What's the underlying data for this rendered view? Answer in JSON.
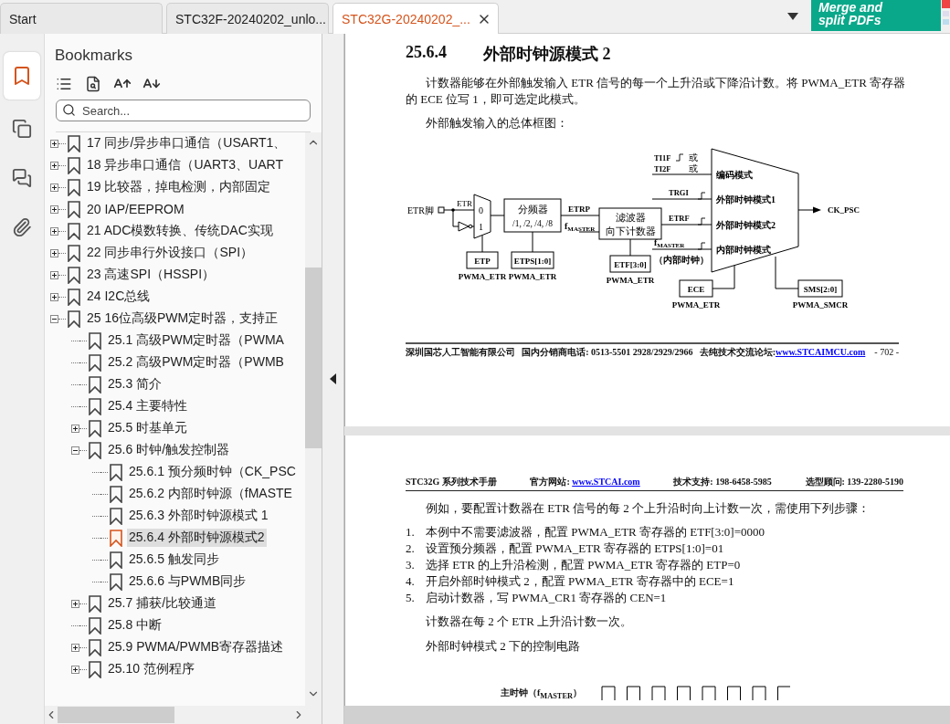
{
  "tabs": [
    {
      "label": "Start",
      "selected": false
    },
    {
      "label": "STC32F-20240202_unlo...",
      "selected": false
    },
    {
      "label": "STC32G-20240202_...",
      "selected": true
    }
  ],
  "ad": {
    "lines": [
      "Merge and",
      "split PDFs"
    ]
  },
  "rail": [
    {
      "kind": "bookmarks",
      "selected": true
    },
    {
      "kind": "pages",
      "selected": false
    },
    {
      "kind": "comments",
      "selected": false
    },
    {
      "kind": "attachments",
      "selected": false
    }
  ],
  "sidebar": {
    "title": "Bookmarks",
    "search": {
      "placeholder": "Search..."
    },
    "items": [
      {
        "label": "17 同步/异步串口通信（USART1、",
        "selected": false,
        "expanded": false
      },
      {
        "label": "18 异步串口通信（UART3、UART",
        "selected": false,
        "expanded": false
      },
      {
        "label": "19 比较器，掉电检测，内部固定",
        "selected": false,
        "expanded": false
      },
      {
        "label": "20 IAP/EEPROM",
        "selected": false,
        "expanded": false
      },
      {
        "label": "21 ADC模数转换、传统DAC实现",
        "selected": false,
        "expanded": false
      },
      {
        "label": "22 同步串行外设接口（SPI）",
        "selected": false,
        "expanded": false
      },
      {
        "label": "23 高速SPI（HSSPI）",
        "selected": false,
        "expanded": false
      },
      {
        "label": "24 I2C总线",
        "selected": false,
        "expanded": false
      },
      {
        "label": "25 16位高级PWM定时器，支持正",
        "selected": false,
        "expanded": true,
        "children": [
          {
            "label": "25.1 高级PWM定时器（PWMA",
            "selected": false
          },
          {
            "label": "25.2 高级PWM定时器（PWMB",
            "selected": false
          },
          {
            "label": "25.3 简介",
            "selected": false
          },
          {
            "label": "25.4 主要特性",
            "selected": false
          },
          {
            "label": "25.5 时基单元",
            "selected": false,
            "expanded": false
          },
          {
            "label": "25.6 时钟/触发控制器",
            "selected": false,
            "expanded": true,
            "children": [
              {
                "label": "25.6.1 预分频时钟（CK_PSC",
                "selected": false
              },
              {
                "label": "25.6.2 内部时钟源（fMASTE",
                "selected": false
              },
              {
                "label": "25.6.3 外部时钟源模式 1",
                "selected": false
              },
              {
                "label": "25.6.4 外部时钟源模式2",
                "selected": true
              },
              {
                "label": "25.6.5 触发同步",
                "selected": false
              },
              {
                "label": "25.6.6 与PWMB同步",
                "selected": false
              }
            ]
          },
          {
            "label": "25.7 捕获/比较通道",
            "selected": false,
            "expanded": false
          },
          {
            "label": "25.8 中断",
            "selected": false
          },
          {
            "label": "25.9 PWMA/PWMB寄存器描述",
            "selected": false,
            "expanded": false
          },
          {
            "label": "25.10 范例程序",
            "selected": false,
            "expanded": false
          }
        ]
      }
    ]
  },
  "page1": {
    "heading_number": "25.6.4",
    "heading_title": "外部时钟源模式 2",
    "paragraphs": [
      "计数器能够在外部触发输入 ETR 信号的每一个上升沿或下降沿计数。将 PWMA_ETR 寄存器的 ECE 位写 1，即可选定此模式。",
      "外部触发输入的总体框图："
    ],
    "diagram": {
      "pin": "ETR脚",
      "etr": "ETR",
      "mux_inputs": [
        "0",
        "1"
      ],
      "prescaler": [
        "分频器",
        "/1, /2, /4, /8"
      ],
      "etrp": "ETRP",
      "fmaster": {
        "main": "f",
        "sub": "MASTER"
      },
      "filter": [
        "滤波器",
        "向下计数器"
      ],
      "etrf": "ETRF",
      "trgi": "TRGI",
      "ti": [
        "TI1F",
        "TI2F"
      ],
      "or": [
        "或",
        "或"
      ],
      "fmaster_internal": {
        "main": "f",
        "sub": "MASTER"
      },
      "internal": "（内部时钟）",
      "modes": [
        "编码模式",
        "外部时钟模式1",
        "外部时钟模式2",
        "内部时钟模式"
      ],
      "output": "CK_PSC",
      "registers": [
        {
          "field": "ETP",
          "reg": "PWMA_ETR"
        },
        {
          "field": "ETPS[1:0]",
          "reg": "PWMA_ETR"
        },
        {
          "field": "ETF[3:0]",
          "reg": "PWMA_ETR"
        },
        {
          "field": "ECE",
          "reg": "PWMA_ETR"
        },
        {
          "field": "SMS[2:0]",
          "reg": "PWMA_SMCR"
        }
      ]
    },
    "footer": {
      "company": "深圳国芯人工智能有限公司",
      "phone": "国内分销商电话: 0513-5501 2928/2929/2966",
      "forum_label": "去纯技术交流论坛:",
      "forum_link": "www.STCAIMCU.com",
      "page": "- 702 -"
    }
  },
  "page2": {
    "header": {
      "manual": "STC32G 系列技术手册",
      "site_label": "官方网站:",
      "site_link": "www.STCAI.com",
      "support": "技术支持: 198-6458-5985",
      "advisor": "选型顾问: 139-2280-5190"
    },
    "intro": "例如，要配置计数器在 ETR 信号的每 2 个上升沿时向上计数一次，需使用下列步骤：",
    "steps": [
      {
        "number": "1.",
        "text": "本例中不需要滤波器，配置 PWMA_ETR 寄存器的 ETF[3:0]=0000"
      },
      {
        "number": "2.",
        "text": "设置预分频器，配置 PWMA_ETR 寄存器的 ETPS[1:0]=01"
      },
      {
        "number": "3.",
        "text": "选择 ETR 的上升沿检测，配置 PWMA_ETR 寄存器的 ETP=0"
      },
      {
        "number": "4.",
        "text": "开启外部时钟模式 2，配置 PWMA_ETR 寄存器中的 ECE=1"
      },
      {
        "number": "5.",
        "text": "启动计数器，写 PWMA_CR1 寄存器的 CEN=1"
      }
    ],
    "notes": [
      "计数器在每 2 个 ETR 上升沿计数一次。",
      "外部时钟模式 2 下的控制电路"
    ],
    "timing_label": "主时钟（f$_{MASTER}$）"
  }
}
